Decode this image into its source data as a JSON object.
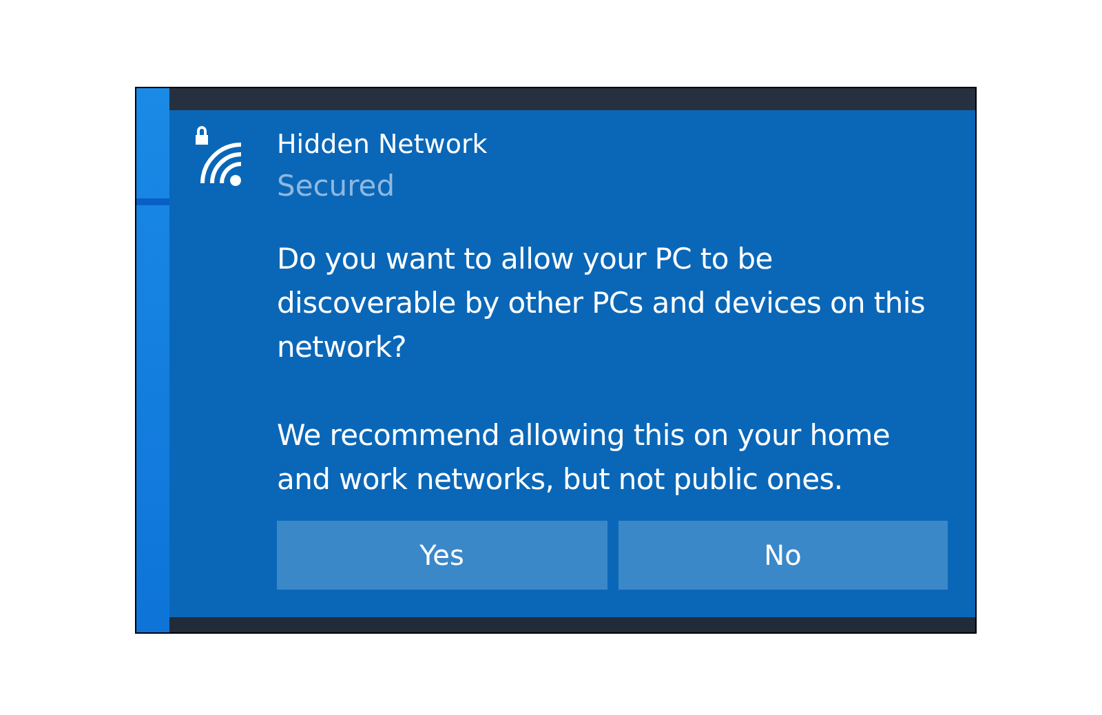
{
  "network": {
    "name": "Hidden Network",
    "status": "Secured"
  },
  "paragraphs": [
    "Do you want to allow your PC to be discoverable by other PCs and devices on this network?",
    "We recommend allowing this on your home and work networks, but not public ones."
  ],
  "buttons": [
    "Yes",
    "No"
  ]
}
